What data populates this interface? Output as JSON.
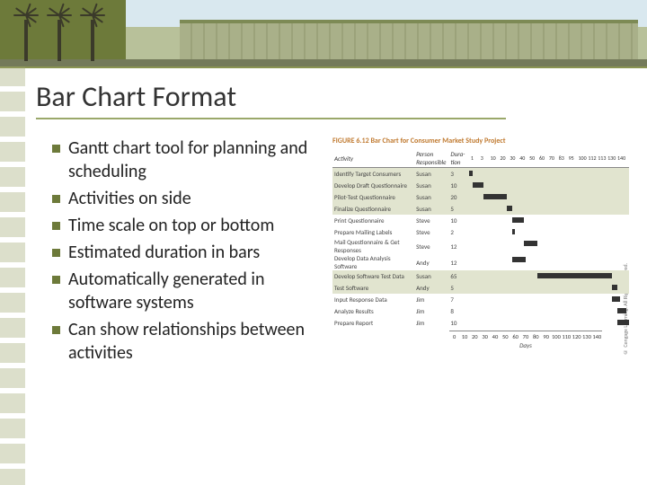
{
  "title": "Bar Chart Format",
  "bullets": [
    "Gantt chart tool for planning and scheduling",
    "Activities on side",
    "Time scale on top or bottom",
    "Estimated duration in bars",
    "Automatically generated in software systems",
    "Can show relationships between activities"
  ],
  "figure": {
    "caption": "FIGURE 6.12  Bar Chart for Consumer Market Study Project",
    "headers": {
      "activity": "Activity",
      "person": "Person Responsible",
      "dur": "Dura-tion"
    },
    "day_ticks_top": [
      "1",
      "3",
      "10",
      "20",
      "30",
      "40",
      "50",
      "60",
      "70",
      "83",
      "95",
      "100",
      "112",
      "113",
      "130",
      "140"
    ],
    "axis_ticks": [
      "0",
      "10",
      "20",
      "30",
      "40",
      "50",
      "60",
      "70",
      "80",
      "90",
      "100",
      "110",
      "120",
      "130",
      "140"
    ],
    "axis_label": "Days",
    "copyright": "© Cengage Learning. All Rights Reserved."
  },
  "chart_data": {
    "type": "bar",
    "title": "Bar Chart for Consumer Market Study Project",
    "xlabel": "Days",
    "ylabel": "Activity",
    "xlim": [
      0,
      140
    ],
    "series": [
      {
        "name": "Identify Target Consumers",
        "person": "Susan",
        "dur": 3,
        "start": 0,
        "end": 3
      },
      {
        "name": "Develop Draft Questionnaire",
        "person": "Susan",
        "dur": 10,
        "start": 3,
        "end": 13
      },
      {
        "name": "Pilot-Test Questionnaire",
        "person": "Susan",
        "dur": 20,
        "start": 13,
        "end": 33
      },
      {
        "name": "Finalize Questionnaire",
        "person": "Susan",
        "dur": 5,
        "start": 33,
        "end": 38
      },
      {
        "name": "Print Questionnaire",
        "person": "Steve",
        "dur": 10,
        "start": 38,
        "end": 48
      },
      {
        "name": "Prepare Mailing Labels",
        "person": "Steve",
        "dur": 2,
        "start": 38,
        "end": 40
      },
      {
        "name": "Mail Questionnaire & Get Responses",
        "person": "Steve",
        "dur": 12,
        "start": 48,
        "end": 60
      },
      {
        "name": "Develop Data Analysis Software",
        "person": "Andy",
        "dur": 12,
        "start": 38,
        "end": 50
      },
      {
        "name": "Develop Software Test Data",
        "person": "Susan",
        "dur": 65,
        "start": 60,
        "end": 125
      },
      {
        "name": "Test Software",
        "person": "Andy",
        "dur": 5,
        "start": 125,
        "end": 130
      },
      {
        "name": "Input Response Data",
        "person": "Jim",
        "dur": 7,
        "start": 125,
        "end": 132
      },
      {
        "name": "Analyze Results",
        "person": "Jim",
        "dur": 8,
        "start": 130,
        "end": 138
      },
      {
        "name": "Prepare Report",
        "person": "Jim",
        "dur": 10,
        "start": 130,
        "end": 140
      }
    ]
  }
}
